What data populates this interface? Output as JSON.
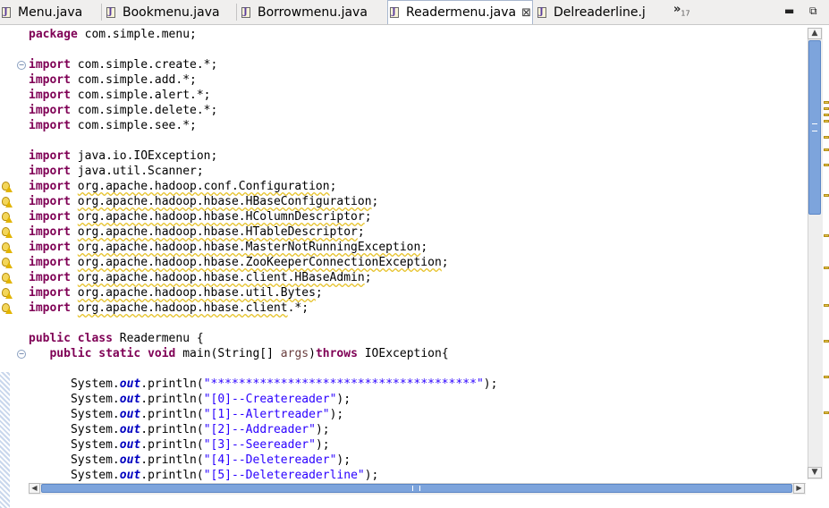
{
  "tabs": [
    {
      "label": "Menu.java"
    },
    {
      "label": "Bookmenu.java"
    },
    {
      "label": "Borrowmenu.java"
    },
    {
      "label": "Readermenu.java",
      "active": true,
      "close": "⊠"
    },
    {
      "label": "Delreaderline.j"
    }
  ],
  "tab_overflow": {
    "symbol": "»",
    "count": "17"
  },
  "window_controls": {
    "minimize": "▬",
    "restore": "⧉"
  },
  "code": {
    "l1": {
      "kw": "package",
      "rest": " com.simple.menu;"
    },
    "l3": {
      "kw": "import",
      "rest": " com.simple.create.*;"
    },
    "l4": {
      "kw": "import",
      "rest": " com.simple.add.*;"
    },
    "l5": {
      "kw": "import",
      "rest": " com.simple.alert.*;"
    },
    "l6": {
      "kw": "import",
      "rest": " com.simple.delete.*;"
    },
    "l7": {
      "kw": "import",
      "rest": " com.simple.see.*;"
    },
    "l9": {
      "kw": "import",
      "rest": " java.io.IOException;"
    },
    "l10": {
      "kw": "import",
      "rest": " java.util.Scanner;"
    },
    "l11": {
      "kw": "import",
      "pkg": "org.apache.hadoop.conf.Configuration",
      "end": ";"
    },
    "l12": {
      "kw": "import",
      "pkg": "org.apache.hadoop.hbase.HBaseConfiguration",
      "end": ";"
    },
    "l13": {
      "kw": "import",
      "pkg": "org.apache.hadoop.hbase.HColumnDescriptor",
      "end": ";"
    },
    "l14": {
      "kw": "import",
      "pkg": "org.apache.hadoop.hbase.HTableDescriptor",
      "end": ";"
    },
    "l15": {
      "kw": "import",
      "pkg": "org.apache.hadoop.hbase.MasterNotRunningException",
      "end": ";"
    },
    "l16": {
      "kw": "import",
      "pkg": "org.apache.hadoop.hbase.ZooKeeperConnectionException",
      "end": ";"
    },
    "l17": {
      "kw": "import",
      "pkg": "org.apache.hadoop.hbase.client.HBaseAdmin",
      "end": ";"
    },
    "l18": {
      "kw": "import",
      "pkg": "org.apache.hadoop.hbase.util.Bytes",
      "end": ";"
    },
    "l19": {
      "kw": "import",
      "pkg": "org.apache.hadoop.hbase.client",
      "end": ".*;"
    },
    "l21": {
      "kw1": "public",
      "kw2": "class",
      "rest": " Readermenu {"
    },
    "l22": {
      "kw1": "public",
      "kw2": "static",
      "kw3": "void",
      "pre": " main(String[] ",
      "param": "args",
      "post": ")",
      "kw4": "throws",
      "rest": " IOException{"
    },
    "println": {
      "sys": "System.",
      "out": "out",
      "call": ".println(",
      "end": ");"
    },
    "l24": "\"**************************************\"",
    "l25": "\"[0]--Createreader\"",
    "l26": "\"[1]--Alertreader\"",
    "l27": "\"[2]--Addreader\"",
    "l28": "\"[3]--Seereader\"",
    "l29": "\"[4]--Deletereader\"",
    "l30": "\"[5]--Deletereaderline\""
  },
  "colors": {
    "keyword": "#7f0055",
    "string": "#2a00ff",
    "field": "#0000c0",
    "scrollbar": "#7da4dc"
  }
}
